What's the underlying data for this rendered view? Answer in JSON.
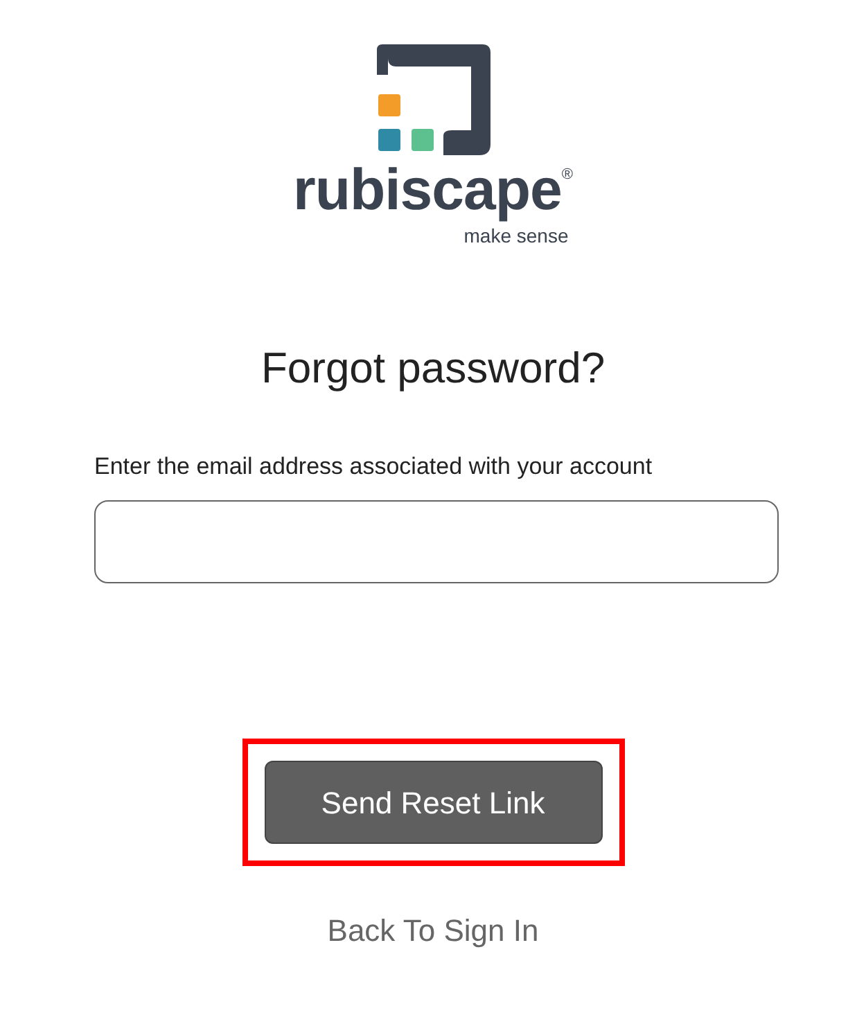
{
  "logo": {
    "wordmark": "rubiscape",
    "registered": "®",
    "tagline": "make sense"
  },
  "title": "Forgot password?",
  "email_field": {
    "label": "Enter the email address associated with your account"
  },
  "submit_button": {
    "label": "Send Reset Link",
    "highlighted": true
  },
  "back_link": {
    "label": "Back To Sign In"
  }
}
